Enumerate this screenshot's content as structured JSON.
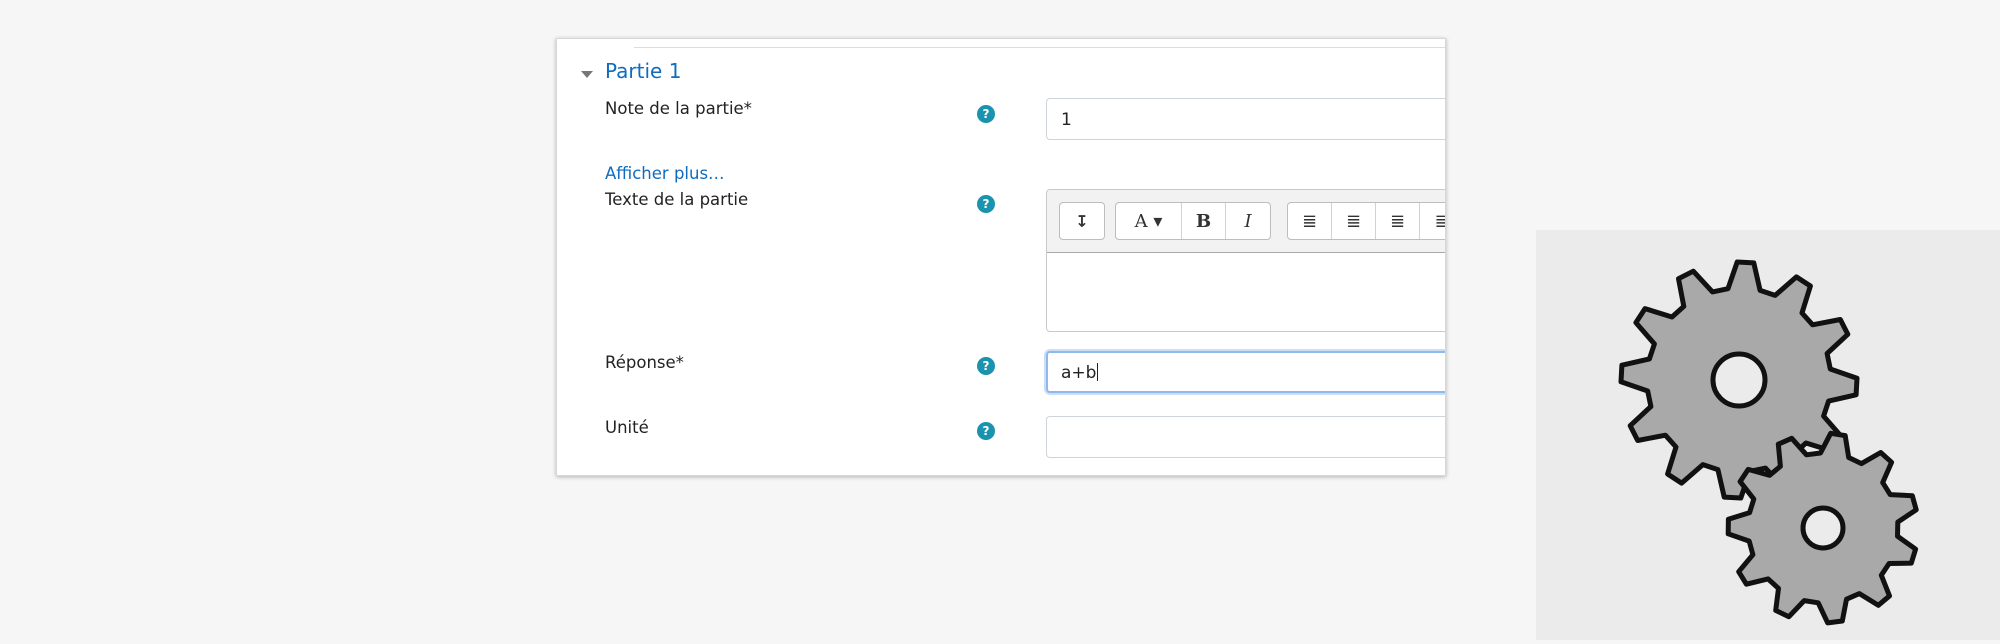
{
  "section": {
    "title": "Partie 1",
    "caret_icon": "caret-down-icon"
  },
  "fields": {
    "mark": {
      "label": "Note de la partie*",
      "value": "1"
    },
    "show_more": {
      "label": "Afficher plus…"
    },
    "text": {
      "label": "Texte de la partie",
      "value": ""
    },
    "answer": {
      "label": "Réponse*",
      "value": "a+b"
    },
    "unit": {
      "label": "Unité",
      "value": ""
    }
  },
  "help_icon_glyph": "?",
  "toolbar": {
    "buttons": [
      {
        "name": "toggle-toolbar-icon",
        "glyph": "↧"
      },
      {
        "name": "font-style-icon",
        "glyph": "A ▾"
      },
      {
        "name": "bold-icon",
        "glyph": "B"
      },
      {
        "name": "italic-icon",
        "glyph": "I"
      },
      {
        "name": "bullet-list-icon",
        "glyph": "≣"
      },
      {
        "name": "numbered-list-icon",
        "glyph": "≣"
      },
      {
        "name": "outdent-icon",
        "glyph": "≣"
      },
      {
        "name": "indent-icon",
        "glyph": "≣"
      }
    ]
  },
  "colors": {
    "accent": "#0f6cbf",
    "help": "#1a93ae",
    "focus": "#8fb8ec",
    "gear": "#a9a9a9"
  },
  "illustration": {
    "icon": "gears-icon"
  }
}
